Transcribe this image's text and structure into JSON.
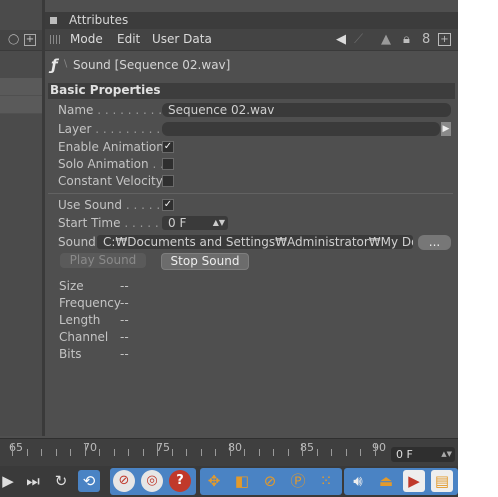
{
  "panel": {
    "title": "Attributes",
    "menus": [
      "Mode",
      "Edit",
      "User Data"
    ]
  },
  "object": {
    "name": "Sound [Sequence 02.wav]"
  },
  "section": {
    "title": "Basic Properties"
  },
  "basic": {
    "name_label": "Name",
    "name_value": "Sequence 02.wav",
    "layer_label": "Layer",
    "layer_value": "",
    "enable_animation_label": "Enable Animation",
    "enable_animation": true,
    "solo_animation_label": "Solo Animation",
    "solo_animation": false,
    "constant_velocity_label": "Constant Velocity",
    "constant_velocity": false
  },
  "sound": {
    "use_sound_label": "Use Sound",
    "use_sound": true,
    "start_time_label": "Start Time",
    "start_time_value": "0 F",
    "sound_label": "Sound",
    "sound_path": "C:₩Documents and Settings₩Administrator₩My Docu",
    "browse_label": "...",
    "play_label": "Play Sound",
    "stop_label": "Stop Sound"
  },
  "info": [
    {
      "label": "Size",
      "value": "--"
    },
    {
      "label": "Frequency",
      "value": "--"
    },
    {
      "label": "Length",
      "value": "--"
    },
    {
      "label": "Channel",
      "value": "--"
    },
    {
      "label": "Bits",
      "value": "--"
    }
  ],
  "timeline": {
    "labels": [
      "65",
      "70",
      "75",
      "80",
      "85",
      "90"
    ],
    "current_frame": "0 F"
  },
  "icons": {
    "accent_orange": "#e39a2b",
    "accent_blue": "#4a83c4",
    "accent_red": "#c0392b"
  }
}
